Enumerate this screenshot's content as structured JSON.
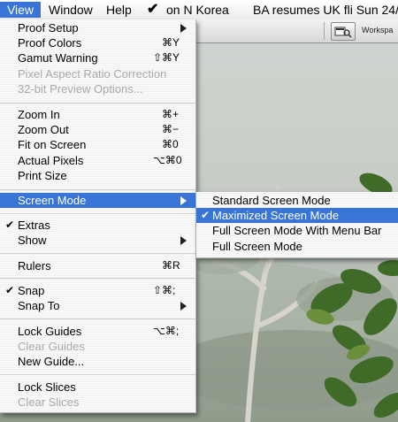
{
  "menubar": {
    "items": [
      "View",
      "Window",
      "Help"
    ],
    "news_check": "✔",
    "news": [
      "on N Korea",
      "BA resumes UK fli Sun 24/"
    ]
  },
  "toolbar": {
    "workspace_label": "Workspa"
  },
  "view_menu": {
    "items": [
      {
        "label": "Proof Setup",
        "shortcut": "",
        "submenu": true,
        "disabled": false,
        "checked": false
      },
      {
        "label": "Proof Colors",
        "shortcut": "⌘Y",
        "submenu": false,
        "disabled": false,
        "checked": false
      },
      {
        "label": "Gamut Warning",
        "shortcut": "⇧⌘Y",
        "submenu": false,
        "disabled": false,
        "checked": false
      },
      {
        "label": "Pixel Aspect Ratio Correction",
        "shortcut": "",
        "submenu": false,
        "disabled": true,
        "checked": false
      },
      {
        "label": "32-bit Preview Options...",
        "shortcut": "",
        "submenu": false,
        "disabled": true,
        "checked": false
      },
      {
        "label": "Zoom In",
        "shortcut": "⌘+",
        "submenu": false,
        "disabled": false,
        "checked": false
      },
      {
        "label": "Zoom Out",
        "shortcut": "⌘−",
        "submenu": false,
        "disabled": false,
        "checked": false
      },
      {
        "label": "Fit on Screen",
        "shortcut": "⌘0",
        "submenu": false,
        "disabled": false,
        "checked": false
      },
      {
        "label": "Actual Pixels",
        "shortcut": "⌥⌘0",
        "submenu": false,
        "disabled": false,
        "checked": false
      },
      {
        "label": "Print Size",
        "shortcut": "",
        "submenu": false,
        "disabled": false,
        "checked": false
      },
      {
        "label": "Screen Mode",
        "shortcut": "",
        "submenu": true,
        "disabled": false,
        "checked": false,
        "selected": true
      },
      {
        "label": "Extras",
        "shortcut": "",
        "submenu": false,
        "disabled": false,
        "checked": true
      },
      {
        "label": "Show",
        "shortcut": "",
        "submenu": true,
        "disabled": false,
        "checked": false
      },
      {
        "label": "Rulers",
        "shortcut": "⌘R",
        "submenu": false,
        "disabled": false,
        "checked": false
      },
      {
        "label": "Snap",
        "shortcut": "⇧⌘;",
        "submenu": false,
        "disabled": false,
        "checked": true
      },
      {
        "label": "Snap To",
        "shortcut": "",
        "submenu": true,
        "disabled": false,
        "checked": false
      },
      {
        "label": "Lock Guides",
        "shortcut": "⌥⌘;",
        "submenu": false,
        "disabled": false,
        "checked": false
      },
      {
        "label": "Clear Guides",
        "shortcut": "",
        "submenu": false,
        "disabled": true,
        "checked": false
      },
      {
        "label": "New Guide...",
        "shortcut": "",
        "submenu": false,
        "disabled": false,
        "checked": false
      },
      {
        "label": "Lock Slices",
        "shortcut": "",
        "submenu": false,
        "disabled": false,
        "checked": false
      },
      {
        "label": "Clear Slices",
        "shortcut": "",
        "submenu": false,
        "disabled": true,
        "checked": false
      }
    ]
  },
  "screen_mode_submenu": {
    "items": [
      {
        "label": "Standard Screen Mode",
        "checked": false
      },
      {
        "label": "Maximized Screen Mode",
        "checked": true,
        "selected": true
      },
      {
        "label": "Full Screen Mode With Menu Bar",
        "checked": false
      },
      {
        "label": "Full Screen Mode",
        "checked": false
      }
    ]
  },
  "colors": {
    "selection": "#3875d7",
    "disabled_text": "#a9a9a9"
  }
}
